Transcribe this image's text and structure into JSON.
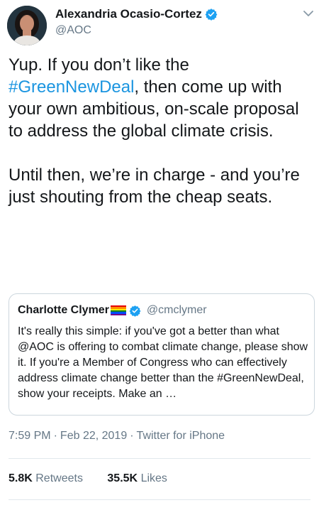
{
  "author": {
    "display_name": "Alexandria Ocasio-Cortez",
    "handle": "@AOC",
    "verified": true
  },
  "tweet": {
    "text_before_hashtag": "Yup. If you don’t like the ",
    "hashtag": "#GreenNewDeal",
    "text_after_hashtag": ", then come up with your own ambitious, on-scale proposal to address the global climate crisis.",
    "paragraph_2": "Until then, we’re in charge - and you’re just shouting from the cheap seats."
  },
  "quoted_tweet": {
    "display_name": "Charlotte Clymer",
    "handle": "@cmclymer",
    "verified": true,
    "text": "It's really this simple: if you've got a better than what @AOC is offering to combat climate change, please show it. If you're a Member of Congress who can effectively address climate change better than the #GreenNewDeal, show your receipts. Make an …"
  },
  "meta": {
    "time": "7:59 PM",
    "date": "Feb 22, 2019",
    "client": "Twitter for iPhone",
    "separator": "·"
  },
  "stats": {
    "retweets_count": "5.8K",
    "retweets_label": "Retweets",
    "likes_count": "35.5K",
    "likes_label": "Likes"
  },
  "icons": {
    "verified_badge": "verified-icon",
    "more_menu": "chevron-down-icon",
    "pride_flag": "rainbow-flag-icon"
  },
  "colors": {
    "link": "#1b95e0",
    "verified": "#1da1f2",
    "secondary_text": "#657786",
    "border": "#ccd6dd"
  }
}
